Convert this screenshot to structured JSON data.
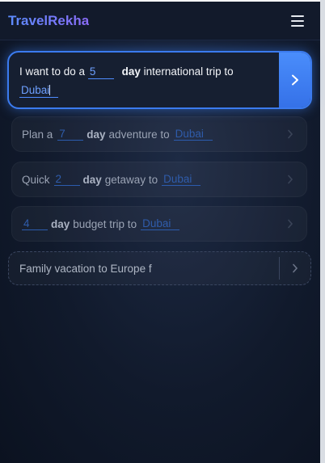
{
  "app": {
    "brand": "TravelRekha"
  },
  "active_prompt": {
    "prefix": "I want to do a",
    "days": "5",
    "day_word": "day",
    "suffix": "international trip to",
    "destination": "Dubai"
  },
  "suggestions": [
    {
      "prefix": "Plan a",
      "days": "7",
      "day_word": "day",
      "suffix": "adventure to",
      "destination": "Dubai"
    },
    {
      "prefix": "Quick",
      "days": "2",
      "day_word": "day",
      "suffix": "getaway to",
      "destination": "Dubai"
    },
    {
      "prefix": "",
      "days": "4",
      "day_word": "day",
      "suffix": "budget trip to",
      "destination": "Dubai"
    }
  ],
  "typed_prompt": "Family vacation to Europe f",
  "colors": {
    "accent": "#3b7bef",
    "brand_start": "#5b8cff",
    "brand_end": "#8a6cf7"
  }
}
